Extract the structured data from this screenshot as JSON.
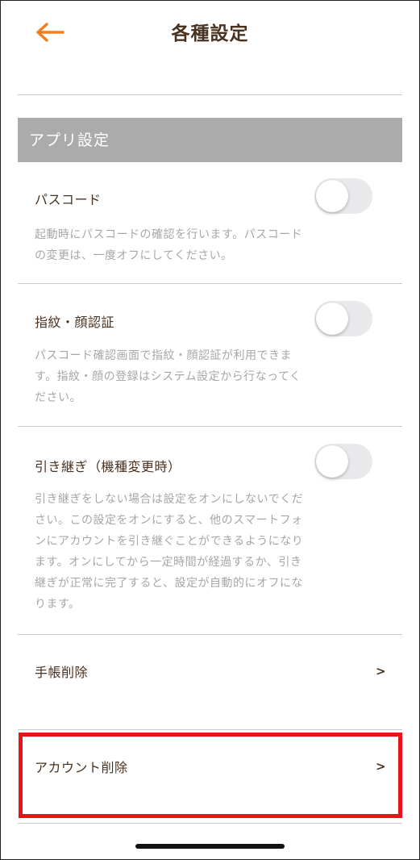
{
  "header": {
    "title": "各種設定",
    "back_icon": "arrow-left-icon",
    "accent_color": "#f07f1f"
  },
  "section": {
    "title": "アプリ設定"
  },
  "settings": [
    {
      "title": "パスコード",
      "description": "起動時にパスコードの確認を行います。パスコードの変更は、一度オフにしてください。",
      "enabled": false
    },
    {
      "title": "指紋・顔認証",
      "description": "パスコード確認画面で指紋・顔認証が利用できます。指紋・顔の登録はシステム設定から行なってください。",
      "enabled": false
    },
    {
      "title": "引き継ぎ（機種変更時）",
      "description": "引き継ぎをしない場合は設定をオンにしないでください。この設定をオンにすると、他のスマートフォンにアカウントを引き継ぐことができるようになります。オンにしてから一定時間が経過するか、引き継ぎが正常に完了すると、設定が自動的にオフになります。",
      "enabled": false
    }
  ],
  "nav_items": [
    {
      "label": "手帳削除",
      "chevron": ">"
    },
    {
      "label": "アカウント削除",
      "chevron": ">"
    }
  ],
  "highlight_color": "#e8141b"
}
